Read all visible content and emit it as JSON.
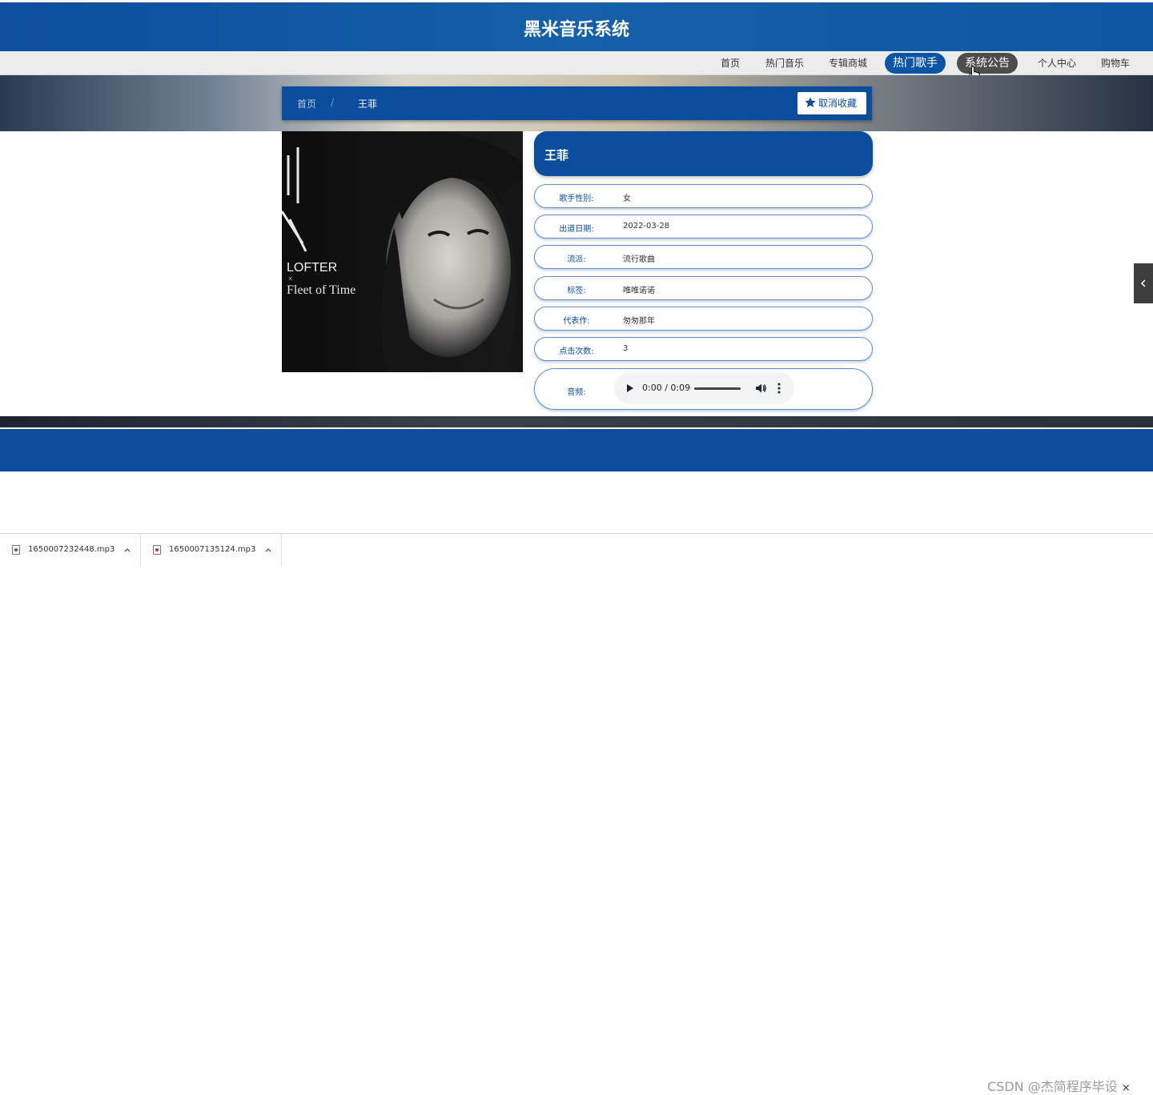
{
  "header": {
    "title": "黑米音乐系统"
  },
  "nav": {
    "items": [
      {
        "label": "首页"
      },
      {
        "label": "热门音乐"
      },
      {
        "label": "专辑商城"
      },
      {
        "label": "热门歌手"
      },
      {
        "label": "系统公告"
      },
      {
        "label": "个人中心"
      },
      {
        "label": "购物车"
      }
    ],
    "active_index": 3,
    "hover_index": 4
  },
  "breadcrumb": {
    "home": "首页",
    "separator": "/",
    "current": "王菲"
  },
  "favorite": {
    "label": "取消收藏",
    "icon": "star-icon"
  },
  "artist": {
    "name": "王菲",
    "photo_text": {
      "brand": "LOFTER",
      "x": "×",
      "caption": "Fleet of Time"
    },
    "details": [
      {
        "label": "歌手性别:",
        "value": "女"
      },
      {
        "label": "出道日期:",
        "value": "2022-03-28"
      },
      {
        "label": "流派:",
        "value": "流行歌曲"
      },
      {
        "label": "标签:",
        "value": "唯唯诺诺"
      },
      {
        "label": "代表作:",
        "value": "匆匆那年"
      },
      {
        "label": "点击次数:",
        "value": "3"
      }
    ],
    "audio": {
      "label": "音频:",
      "time": "0:00 / 0:09"
    }
  },
  "downloads": [
    {
      "name": "1650007232448.mp3"
    },
    {
      "name": "1650007135124.mp3"
    }
  ],
  "watermark": "CSDN @杰简程序毕设",
  "close_char": "×",
  "colors": {
    "primary": "#0a4d9c",
    "nav_bg": "#ececec",
    "active_pill": "#0a56a5",
    "hover_pill": "#4d4d4d"
  }
}
